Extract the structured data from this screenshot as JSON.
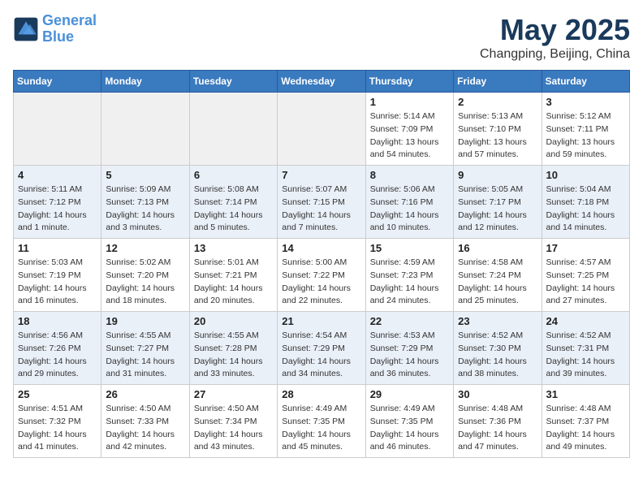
{
  "header": {
    "logo_line1": "General",
    "logo_line2": "Blue",
    "month": "May 2025",
    "location": "Changping, Beijing, China"
  },
  "weekdays": [
    "Sunday",
    "Monday",
    "Tuesday",
    "Wednesday",
    "Thursday",
    "Friday",
    "Saturday"
  ],
  "weeks": [
    [
      {
        "day": "",
        "info": ""
      },
      {
        "day": "",
        "info": ""
      },
      {
        "day": "",
        "info": ""
      },
      {
        "day": "",
        "info": ""
      },
      {
        "day": "1",
        "info": "Sunrise: 5:14 AM\nSunset: 7:09 PM\nDaylight: 13 hours\nand 54 minutes."
      },
      {
        "day": "2",
        "info": "Sunrise: 5:13 AM\nSunset: 7:10 PM\nDaylight: 13 hours\nand 57 minutes."
      },
      {
        "day": "3",
        "info": "Sunrise: 5:12 AM\nSunset: 7:11 PM\nDaylight: 13 hours\nand 59 minutes."
      }
    ],
    [
      {
        "day": "4",
        "info": "Sunrise: 5:11 AM\nSunset: 7:12 PM\nDaylight: 14 hours\nand 1 minute."
      },
      {
        "day": "5",
        "info": "Sunrise: 5:09 AM\nSunset: 7:13 PM\nDaylight: 14 hours\nand 3 minutes."
      },
      {
        "day": "6",
        "info": "Sunrise: 5:08 AM\nSunset: 7:14 PM\nDaylight: 14 hours\nand 5 minutes."
      },
      {
        "day": "7",
        "info": "Sunrise: 5:07 AM\nSunset: 7:15 PM\nDaylight: 14 hours\nand 7 minutes."
      },
      {
        "day": "8",
        "info": "Sunrise: 5:06 AM\nSunset: 7:16 PM\nDaylight: 14 hours\nand 10 minutes."
      },
      {
        "day": "9",
        "info": "Sunrise: 5:05 AM\nSunset: 7:17 PM\nDaylight: 14 hours\nand 12 minutes."
      },
      {
        "day": "10",
        "info": "Sunrise: 5:04 AM\nSunset: 7:18 PM\nDaylight: 14 hours\nand 14 minutes."
      }
    ],
    [
      {
        "day": "11",
        "info": "Sunrise: 5:03 AM\nSunset: 7:19 PM\nDaylight: 14 hours\nand 16 minutes."
      },
      {
        "day": "12",
        "info": "Sunrise: 5:02 AM\nSunset: 7:20 PM\nDaylight: 14 hours\nand 18 minutes."
      },
      {
        "day": "13",
        "info": "Sunrise: 5:01 AM\nSunset: 7:21 PM\nDaylight: 14 hours\nand 20 minutes."
      },
      {
        "day": "14",
        "info": "Sunrise: 5:00 AM\nSunset: 7:22 PM\nDaylight: 14 hours\nand 22 minutes."
      },
      {
        "day": "15",
        "info": "Sunrise: 4:59 AM\nSunset: 7:23 PM\nDaylight: 14 hours\nand 24 minutes."
      },
      {
        "day": "16",
        "info": "Sunrise: 4:58 AM\nSunset: 7:24 PM\nDaylight: 14 hours\nand 25 minutes."
      },
      {
        "day": "17",
        "info": "Sunrise: 4:57 AM\nSunset: 7:25 PM\nDaylight: 14 hours\nand 27 minutes."
      }
    ],
    [
      {
        "day": "18",
        "info": "Sunrise: 4:56 AM\nSunset: 7:26 PM\nDaylight: 14 hours\nand 29 minutes."
      },
      {
        "day": "19",
        "info": "Sunrise: 4:55 AM\nSunset: 7:27 PM\nDaylight: 14 hours\nand 31 minutes."
      },
      {
        "day": "20",
        "info": "Sunrise: 4:55 AM\nSunset: 7:28 PM\nDaylight: 14 hours\nand 33 minutes."
      },
      {
        "day": "21",
        "info": "Sunrise: 4:54 AM\nSunset: 7:29 PM\nDaylight: 14 hours\nand 34 minutes."
      },
      {
        "day": "22",
        "info": "Sunrise: 4:53 AM\nSunset: 7:29 PM\nDaylight: 14 hours\nand 36 minutes."
      },
      {
        "day": "23",
        "info": "Sunrise: 4:52 AM\nSunset: 7:30 PM\nDaylight: 14 hours\nand 38 minutes."
      },
      {
        "day": "24",
        "info": "Sunrise: 4:52 AM\nSunset: 7:31 PM\nDaylight: 14 hours\nand 39 minutes."
      }
    ],
    [
      {
        "day": "25",
        "info": "Sunrise: 4:51 AM\nSunset: 7:32 PM\nDaylight: 14 hours\nand 41 minutes."
      },
      {
        "day": "26",
        "info": "Sunrise: 4:50 AM\nSunset: 7:33 PM\nDaylight: 14 hours\nand 42 minutes."
      },
      {
        "day": "27",
        "info": "Sunrise: 4:50 AM\nSunset: 7:34 PM\nDaylight: 14 hours\nand 43 minutes."
      },
      {
        "day": "28",
        "info": "Sunrise: 4:49 AM\nSunset: 7:35 PM\nDaylight: 14 hours\nand 45 minutes."
      },
      {
        "day": "29",
        "info": "Sunrise: 4:49 AM\nSunset: 7:35 PM\nDaylight: 14 hours\nand 46 minutes."
      },
      {
        "day": "30",
        "info": "Sunrise: 4:48 AM\nSunset: 7:36 PM\nDaylight: 14 hours\nand 47 minutes."
      },
      {
        "day": "31",
        "info": "Sunrise: 4:48 AM\nSunset: 7:37 PM\nDaylight: 14 hours\nand 49 minutes."
      }
    ]
  ]
}
